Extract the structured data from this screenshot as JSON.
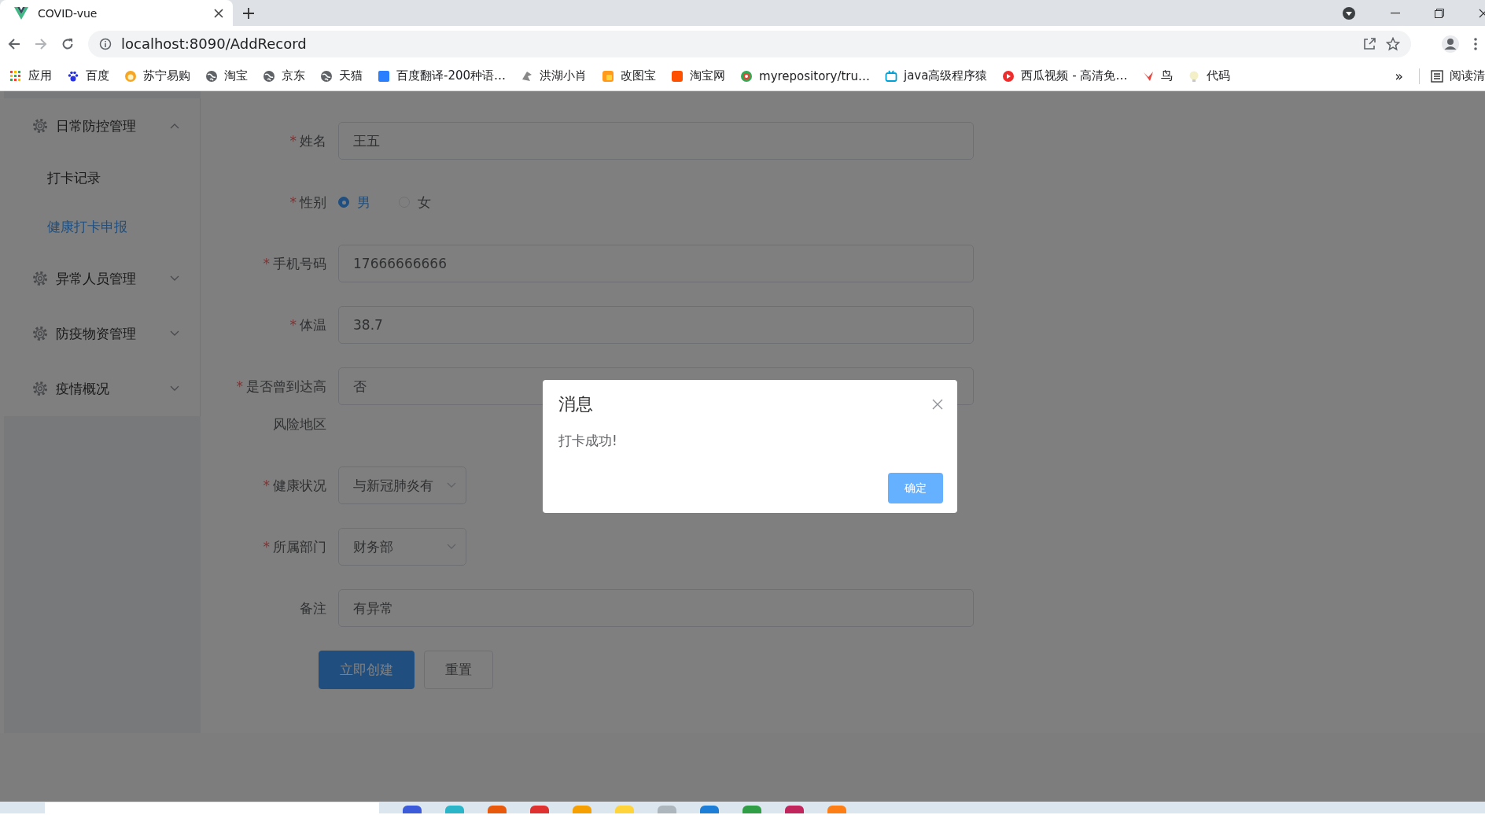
{
  "browser": {
    "tab": {
      "title": "COVID-vue",
      "selected": true
    },
    "address": "localhost:8090/AddRecord",
    "bookmarks": [
      {
        "label": "应用",
        "kind": "apps"
      },
      {
        "label": "百度",
        "kind": "paw"
      },
      {
        "label": "苏宁易购",
        "kind": "lion"
      },
      {
        "label": "淘宝",
        "kind": "globe"
      },
      {
        "label": "京东",
        "kind": "globe"
      },
      {
        "label": "天猫",
        "kind": "globe"
      },
      {
        "label": "百度翻译-200种语…",
        "kind": "square"
      },
      {
        "label": "洪湖小肖",
        "kind": "bird"
      },
      {
        "label": "改图宝",
        "kind": "tile"
      },
      {
        "label": "淘宝网",
        "kind": "tao"
      },
      {
        "label": "myrepository/tru…",
        "kind": "ring"
      },
      {
        "label": "java高级程序猿",
        "kind": "tv"
      },
      {
        "label": "西瓜视频 - 高清免…",
        "kind": "play"
      },
      {
        "label": "鸟",
        "kind": "kite"
      },
      {
        "label": "代码",
        "kind": "bulb"
      }
    ],
    "more": "»",
    "reading_list": "阅读清"
  },
  "sidebar": {
    "menu": [
      {
        "label": "日常防控管理",
        "expanded": true,
        "children": [
          {
            "label": "打卡记录",
            "selected": false
          },
          {
            "label": "健康打卡申报",
            "selected": true
          }
        ]
      },
      {
        "label": "异常人员管理",
        "expanded": false
      },
      {
        "label": "防疫物资管理",
        "expanded": false
      },
      {
        "label": "疫情概况",
        "expanded": false
      }
    ]
  },
  "form": {
    "fields": [
      {
        "kind": "input",
        "required_mark": "*",
        "label": "姓名",
        "value": "王五"
      },
      {
        "kind": "radio",
        "required_mark": "*",
        "label": "性别",
        "options": [
          {
            "label": "男",
            "selected": true
          },
          {
            "label": "女",
            "selected": false
          }
        ]
      },
      {
        "kind": "input",
        "required_mark": "*",
        "label": "手机号码",
        "value": "17666666666"
      },
      {
        "kind": "input",
        "required_mark": "*",
        "label": "体温",
        "value": "38.7"
      },
      {
        "kind": "input",
        "required_mark": "*",
        "label": "是否曾到达高风险地区",
        "value": "否"
      },
      {
        "kind": "select",
        "required_mark": "*",
        "label": "健康状况",
        "value": "与新冠肺炎有"
      },
      {
        "kind": "select",
        "required_mark": "*",
        "label": "所属部门",
        "value": "财务部"
      },
      {
        "kind": "input",
        "label": "备注",
        "value": "有异常"
      }
    ],
    "buttons": [
      {
        "label": "立即创建",
        "kind": "primary"
      },
      {
        "label": "重置",
        "kind": "default"
      }
    ]
  },
  "dialog": {
    "title": "消息",
    "message": "打卡成功!",
    "confirm": "确定"
  }
}
